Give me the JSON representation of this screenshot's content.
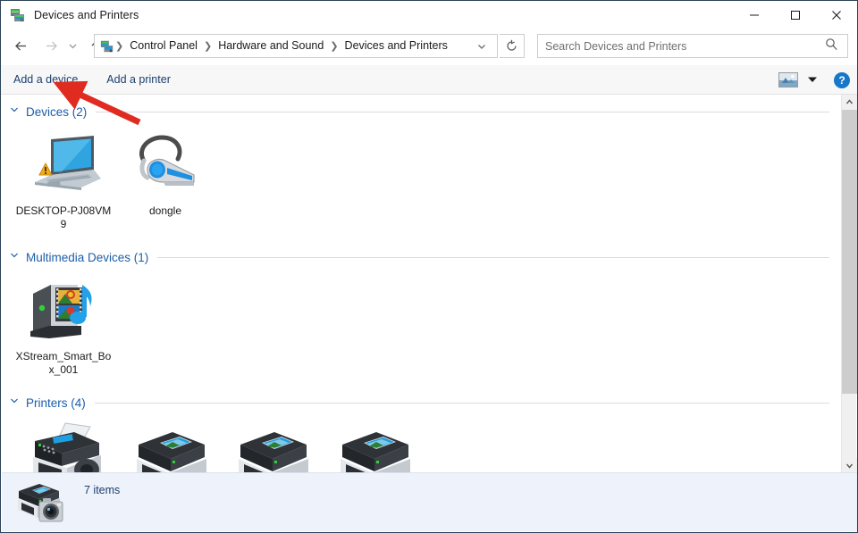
{
  "window": {
    "title": "Devices and Printers",
    "title_icon": "devices-printers-icon",
    "minimize_label": "─",
    "maximize_label": "□",
    "close_label": "✕"
  },
  "navigation": {
    "back_label": "←",
    "forward_label": "→",
    "history_label": "˅",
    "up_label": "↑",
    "refresh_label": "↺",
    "dropdown_label": "˅",
    "breadcrumb": [
      "Control Panel",
      "Hardware and Sound",
      "Devices and Printers"
    ],
    "breadcrumb_separator": "❯"
  },
  "search": {
    "placeholder": "Search Devices and Printers",
    "value": "",
    "icon": "search-icon"
  },
  "toolbar": {
    "add_device_label": "Add a device",
    "add_printer_label": "Add a printer",
    "view_icon": "view-options-icon",
    "view_chevron": "▾",
    "help_label": "?"
  },
  "groups": [
    {
      "id": "devices",
      "title": "Devices (2)",
      "chevron": "˅",
      "items": [
        {
          "label": "DESKTOP-PJ08VM9",
          "icon": "laptop-warning-icon"
        },
        {
          "label": "dongle",
          "icon": "bluetooth-headset-icon"
        }
      ]
    },
    {
      "id": "multimedia-devices",
      "title": "Multimedia Devices (1)",
      "chevron": "˅",
      "items": [
        {
          "label": "XStream_Smart_Box_001",
          "icon": "media-server-icon"
        }
      ]
    },
    {
      "id": "printers",
      "title": "Printers (4)",
      "chevron": "˅",
      "items": [
        {
          "label": "",
          "icon": "fax-printer-icon"
        },
        {
          "label": "",
          "icon": "printer-icon"
        },
        {
          "label": "",
          "icon": "printer-icon"
        },
        {
          "label": "",
          "icon": "printer-icon"
        }
      ]
    }
  ],
  "statusbar": {
    "item_count_label": "7 items",
    "icon": "printer-camera-icon"
  },
  "scrollbar": {
    "up_arrow": "˄",
    "down_arrow": "˅"
  },
  "annotation": {
    "type": "red-arrow",
    "color": "#e02b20",
    "points_at": "Add a device"
  },
  "colors": {
    "group_title": "#1c5ea8",
    "command_link": "#1c3f6e",
    "window_border": "#2b4257",
    "statusbar_bg": "#eef2fb",
    "accent_blue": "#1878c8"
  }
}
